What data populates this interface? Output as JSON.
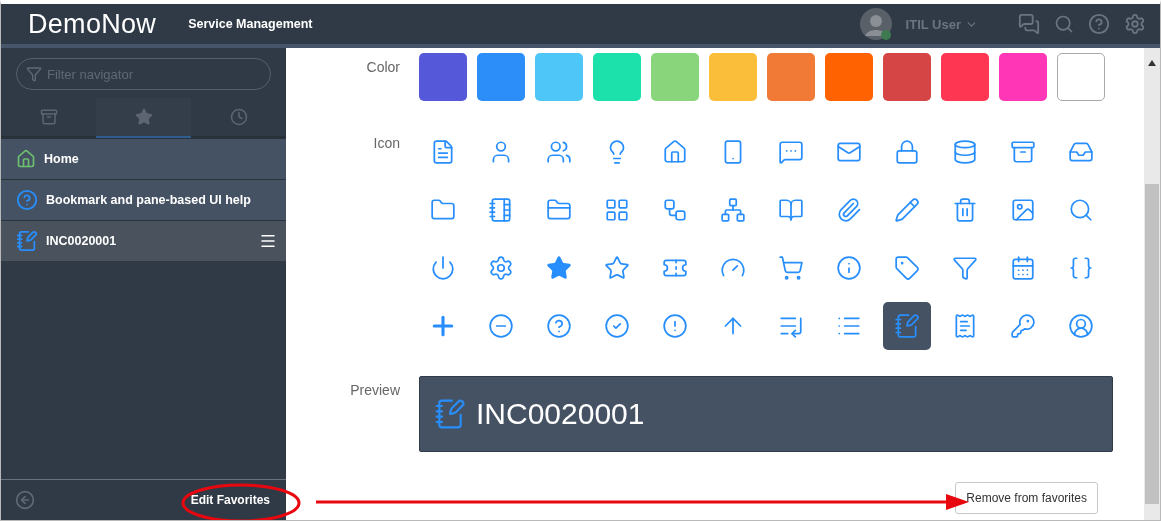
{
  "header": {
    "logo": "DemoNow",
    "product": "Service Management",
    "user": "ITIL User"
  },
  "navigator": {
    "filter_placeholder": "Filter navigator",
    "tabs": [
      {
        "selected": false
      },
      {
        "selected": true
      },
      {
        "selected": false
      }
    ],
    "items": [
      {
        "kind": "home",
        "label": "Home",
        "selected": false
      },
      {
        "kind": "help",
        "label": "Bookmark and pane-based UI help",
        "selected": false
      },
      {
        "kind": "record",
        "label": "INC0020001",
        "selected": true
      }
    ],
    "edit_link": "Edit Favorites"
  },
  "form": {
    "color_label": "Color",
    "colors": [
      {
        "color": "#5558d8"
      },
      {
        "color": "#2b8ef9"
      },
      {
        "color": "#4fc6f8"
      },
      {
        "color": "#1de1ab"
      },
      {
        "color": "#88d57b"
      },
      {
        "color": "#fbbe3a"
      },
      {
        "color": "#f17a37"
      },
      {
        "color": "#ff6200"
      },
      {
        "color": "#d64545"
      },
      {
        "color": "#fe3652"
      },
      {
        "color": "#ff36b6"
      },
      {
        "color": "#ffffff"
      }
    ],
    "icon_label": "Icon",
    "icons": [
      {
        "selected": false
      },
      {
        "selected": false
      },
      {
        "selected": false
      },
      {
        "selected": false
      },
      {
        "selected": false
      },
      {
        "selected": false
      },
      {
        "selected": false
      },
      {
        "selected": false
      },
      {
        "selected": false
      },
      {
        "selected": false
      },
      {
        "selected": false
      },
      {
        "selected": false
      },
      {
        "selected": false
      },
      {
        "selected": false
      },
      {
        "selected": false
      },
      {
        "selected": false
      },
      {
        "selected": false
      },
      {
        "selected": false
      },
      {
        "selected": false
      },
      {
        "selected": false
      },
      {
        "selected": false
      },
      {
        "selected": false
      },
      {
        "selected": false
      },
      {
        "selected": false
      },
      {
        "selected": false
      },
      {
        "selected": false
      },
      {
        "selected": false
      },
      {
        "selected": false
      },
      {
        "selected": false
      },
      {
        "selected": false
      },
      {
        "selected": false
      },
      {
        "selected": false
      },
      {
        "selected": false
      },
      {
        "selected": false
      },
      {
        "selected": false
      },
      {
        "selected": false
      },
      {
        "selected": false
      },
      {
        "selected": false
      },
      {
        "selected": false
      },
      {
        "selected": false
      },
      {
        "selected": false
      },
      {
        "selected": false
      },
      {
        "selected": false
      },
      {
        "selected": false
      },
      {
        "selected": true
      },
      {
        "selected": false
      },
      {
        "selected": false
      },
      {
        "selected": false
      }
    ],
    "preview_label": "Preview",
    "preview_title": "INC0020001",
    "remove_button": "Remove from favorites"
  }
}
